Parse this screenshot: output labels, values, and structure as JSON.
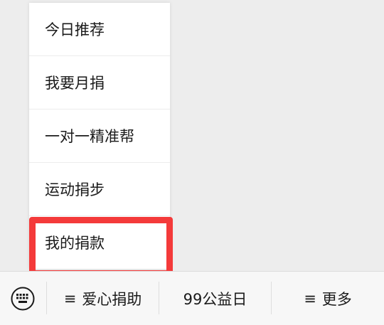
{
  "menu": {
    "items": [
      {
        "label": "今日推荐"
      },
      {
        "label": "我要月捐"
      },
      {
        "label": "一对一精准帮"
      },
      {
        "label": "运动捐步"
      },
      {
        "label": "我的捐款"
      }
    ]
  },
  "bottom_bar": {
    "keyboard_icon": "keyboard-icon",
    "tabs": [
      {
        "glyph": "≡",
        "label": "爱心捐助"
      },
      {
        "glyph": "",
        "label": "99公益日"
      },
      {
        "glyph": "≡",
        "label": "更多"
      }
    ]
  },
  "colors": {
    "highlight": "#f43a3a",
    "background": "#ededed",
    "menu_bg": "#ffffff"
  }
}
